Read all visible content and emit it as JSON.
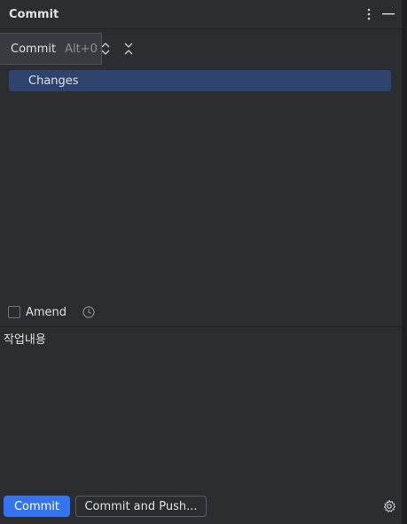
{
  "panel": {
    "title": "Commit"
  },
  "titlebar_icons": [
    "more-options-icon",
    "minimize-icon"
  ],
  "tooltip": {
    "label": "Commit",
    "shortcut": "Alt+0"
  },
  "toolbar_icons": [
    "expand-all-icon",
    "collapse-all-icon"
  ],
  "changes": {
    "group_label": "Changes"
  },
  "amend": {
    "label": "Amend",
    "checked": false
  },
  "commit_message": {
    "value": "작업내용"
  },
  "buttons": {
    "commit": "Commit",
    "commit_and_push": "Commit and Push..."
  },
  "colors": {
    "background": "#2b2d30",
    "selection": "#2e436e",
    "primary": "#3574f0"
  }
}
